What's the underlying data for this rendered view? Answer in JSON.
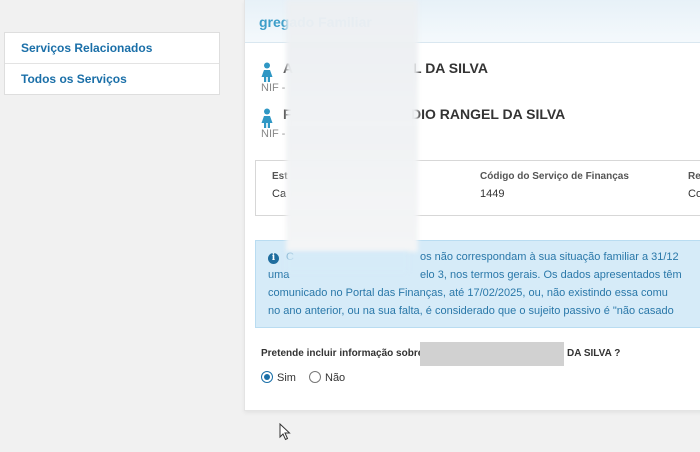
{
  "sidebar": {
    "items": [
      {
        "label": "Serviços Relacionados"
      },
      {
        "label": "Todos os Serviços"
      }
    ]
  },
  "panel": {
    "title": "gregado Familiar",
    "members": [
      {
        "name": "A",
        "name_end": "L DA SILVA",
        "nif": "NIF -",
        "icon": "person-female-icon"
      },
      {
        "name": "F",
        "name_end": "DIO RANGEL DA SILVA",
        "nif": "NIF -",
        "icon": "person-female-icon"
      }
    ],
    "info": {
      "col1": {
        "label": "Est",
        "value": "Ca"
      },
      "col2": {
        "label": "Código do Serviço de Finanças",
        "value": "1449"
      },
      "col3": {
        "label": "Re",
        "value": "Co"
      }
    },
    "alert": {
      "lines": [
        {
          "before": "C",
          "after": "os não correspondam à sua situação familiar a 31/12"
        },
        {
          "before": "uma",
          "after": "elo 3, nos termos gerais. Os dados apresentados têm"
        },
        {
          "before": "",
          "after": "comunicado no Portal das Finanças, até 17/02/2025, ou, não existindo essa comu"
        },
        {
          "before": "",
          "after": "no ano anterior, ou na sua falta, é considerado que o sujeito passivo é \"não casado"
        }
      ]
    },
    "question": {
      "prefix": "Pretende incluir informação sobre",
      "suffix": "DA SILVA ?"
    },
    "options": {
      "yes": {
        "label": "Sim",
        "selected": true
      },
      "no": {
        "label": "Não",
        "selected": false
      }
    }
  },
  "colors": {
    "accent": "#1a6fa8",
    "title": "#3d9ec9",
    "alert_bg": "#d6ebf8"
  }
}
